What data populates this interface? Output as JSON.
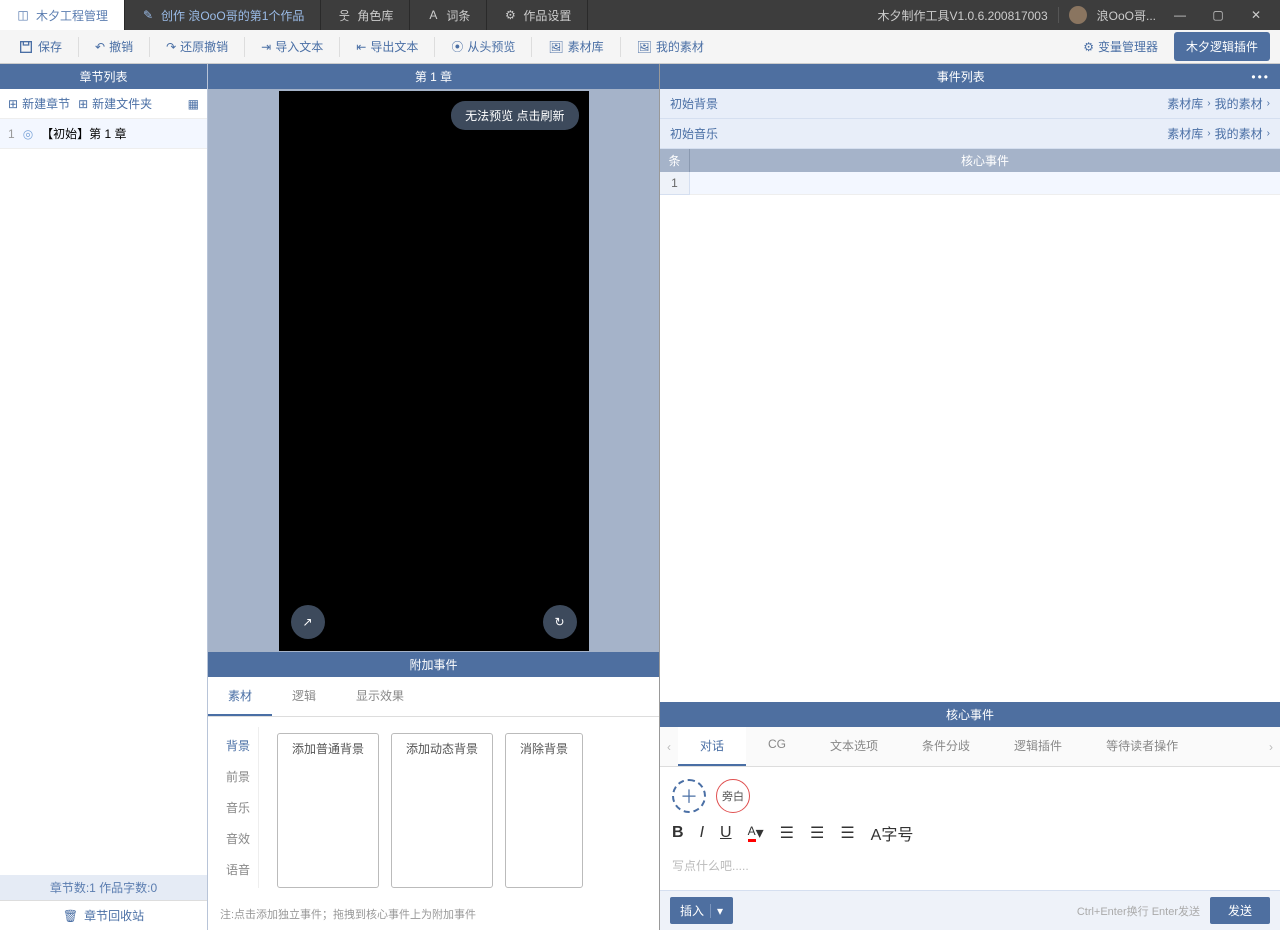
{
  "app": {
    "version_label": "木夕制作工具V1.0.6.200817003",
    "user_name": "浪OoO哥..."
  },
  "tabs": {
    "project": "木夕工程管理",
    "create": "创作 浪OoO哥的第1个作品",
    "roles": "角色库",
    "terms": "词条",
    "settings": "作品设置"
  },
  "toolbar": {
    "save": "保存",
    "undo": "撤销",
    "redo": "还原撤销",
    "import": "导入文本",
    "export": "导出文本",
    "preview_head": "从头预览",
    "asset_lib": "素材库",
    "my_assets": "我的素材",
    "var_mgr": "变量管理器",
    "plugin": "木夕逻辑插件"
  },
  "left": {
    "header": "章节列表",
    "new_chapter": "新建章节",
    "new_folder": "新建文件夹",
    "chapter_num": "1",
    "chapter_name": "【初始】第 1 章",
    "stats": "章节数:1 作品字数:0",
    "recycle": "章节回收站"
  },
  "center": {
    "header": "第 1 章",
    "no_preview": "无法预览 点击刷新",
    "attach_header": "附加事件",
    "attach_tabs": {
      "material": "素材",
      "logic": "逻辑",
      "effect": "显示效果"
    },
    "side_menu": {
      "bg": "背景",
      "fg": "前景",
      "music": "音乐",
      "sfx": "音效",
      "voice": "语音"
    },
    "bg_actions": {
      "add_normal": "添加普通背景",
      "add_dynamic": "添加动态背景",
      "remove": "消除背景"
    },
    "hint": "注:点击添加独立事件；拖拽到核心事件上为附加事件"
  },
  "right": {
    "header": "事件列表",
    "init_bg": "初始背景",
    "init_music": "初始音乐",
    "asset_lib_link": "素材库",
    "my_assets_link": "我的素材",
    "col_index": "条",
    "col_core": "核心事件",
    "row1": "1",
    "core_header": "核心事件",
    "core_tabs": {
      "dialog": "对话",
      "cg": "CG",
      "text_opt": "文本选项",
      "cond": "条件分歧",
      "logic_plugin": "逻辑插件",
      "wait_reader": "等待读者操作"
    },
    "narration": "旁白",
    "format": {
      "bold": "B",
      "italic": "I",
      "underline": "U",
      "color": "A",
      "al": "≡",
      "ac": "≡",
      "ar": "≡",
      "font": "A字号"
    },
    "placeholder": "写点什么吧.....",
    "insert": "插入",
    "send_hint": "Ctrl+Enter换行 Enter发送",
    "send": "发送"
  }
}
